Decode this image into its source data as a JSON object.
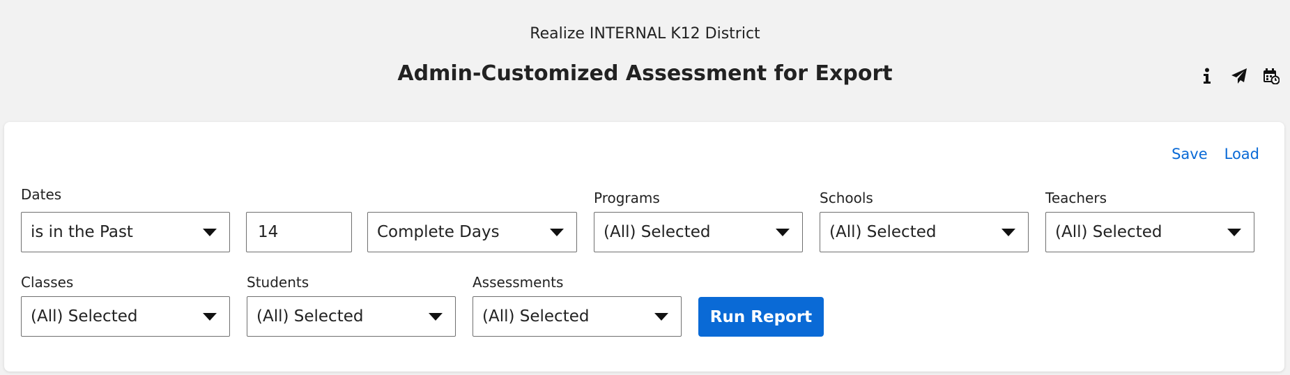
{
  "header": {
    "district": "Realize INTERNAL K12 District",
    "title": "Admin-Customized Assessment for Export",
    "icons": [
      "info-icon",
      "send-icon",
      "schedule-calendar-icon"
    ]
  },
  "actions": {
    "save": "Save",
    "load": "Load"
  },
  "filters": {
    "dates": {
      "label": "Dates",
      "operator": "is in the Past",
      "value": "14",
      "unit": "Complete Days"
    },
    "programs": {
      "label": "Programs",
      "value": "(All) Selected"
    },
    "schools": {
      "label": "Schools",
      "value": "(All) Selected"
    },
    "teachers": {
      "label": "Teachers",
      "value": "(All) Selected"
    },
    "classes": {
      "label": "Classes",
      "value": "(All) Selected"
    },
    "students": {
      "label": "Students",
      "value": "(All) Selected"
    },
    "assessments": {
      "label": "Assessments",
      "value": "(All) Selected"
    }
  },
  "run_button": "Run Report",
  "colors": {
    "accent": "#0a6ad6",
    "background": "#f2f2f2",
    "card": "#ffffff"
  }
}
